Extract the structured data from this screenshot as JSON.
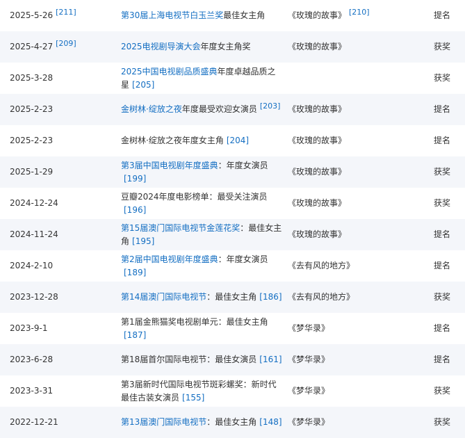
{
  "rows": [
    {
      "date": "2025-5-26",
      "date_ref": "[211]",
      "event_link": "第30届上海电视节白玉兰奖",
      "event_text": "最佳女主角",
      "event_ref": "",
      "work": "《玫瑰的故事》",
      "work_ref": "[210]",
      "result": "提名"
    },
    {
      "date": "2025-4-27",
      "date_ref": "[209]",
      "event_link": "2025电视剧导演大会",
      "event_text": "年度女主角奖",
      "event_ref": "",
      "work": "《玫瑰的故事》",
      "work_ref": "",
      "result": "获奖"
    },
    {
      "date": "2025-3-28",
      "date_ref": "",
      "event_link": "2025中国电视剧品质盛典",
      "event_text": "年度卓越品质之星",
      "event_ref": "[205]",
      "work": "",
      "work_ref": "",
      "result": "获奖"
    },
    {
      "date": "2025-2-23",
      "date_ref": "",
      "event_link": "金树林·绽放之夜",
      "event_text": "年度最受欢迎女演员",
      "event_ref": "[203]",
      "work": "《玫瑰的故事》",
      "work_ref": "",
      "result": "提名"
    },
    {
      "date": "2025-2-23",
      "date_ref": "",
      "event_link": "",
      "event_text": "金树林·绽放之夜年度女主角",
      "event_ref": "[204]",
      "work": "《玫瑰的故事》",
      "work_ref": "",
      "result": "提名"
    },
    {
      "date": "2025-1-29",
      "date_ref": "",
      "event_link": "第3届中国电视剧年度盛典",
      "event_text": "：年度女演员",
      "event_ref": "[199]",
      "work": "《玫瑰的故事》",
      "work_ref": "",
      "result": "获奖"
    },
    {
      "date": "2024-12-24",
      "date_ref": "",
      "event_link": "",
      "event_text": "豆瓣2024年度电影榜单：最受关注演员",
      "event_ref": "[196]",
      "work": "《玫瑰的故事》",
      "work_ref": "",
      "result": "获奖"
    },
    {
      "date": "2024-11-24",
      "date_ref": "",
      "event_link": "第15届澳门国际电视节金莲花奖",
      "event_text": "：最佳女主角",
      "event_ref": "[195]",
      "work": "《玫瑰的故事》",
      "work_ref": "",
      "result": "提名"
    },
    {
      "date": "2024-2-10",
      "date_ref": "",
      "event_link": "第2届中国电视剧年度盛典",
      "event_text": "：年度女演员",
      "event_ref": "[189]",
      "work": "《去有风的地方》",
      "work_ref": "",
      "result": "提名"
    },
    {
      "date": "2023-12-28",
      "date_ref": "",
      "event_link": "第14届澳门国际电视节",
      "event_text": "：最佳女主角",
      "event_ref": "[186]",
      "work": "《去有风的地方》",
      "work_ref": "",
      "result": "获奖"
    },
    {
      "date": "2023-9-1",
      "date_ref": "",
      "event_link": "",
      "event_text": "第1届金熊猫奖电视剧单元：最佳女主角",
      "event_ref": "[187]",
      "work": "《梦华录》",
      "work_ref": "",
      "result": "提名"
    },
    {
      "date": "2023-6-28",
      "date_ref": "",
      "event_link": "",
      "event_text": "第18届首尔国际电视节：最佳女演员",
      "event_ref": "[161]",
      "work": "《梦华录》",
      "work_ref": "",
      "result": "提名"
    },
    {
      "date": "2023-3-31",
      "date_ref": "",
      "event_link": "",
      "event_text": "第3届新时代国际电视节斑彩螺奖：新时代最佳古装女演员",
      "event_ref": "[155]",
      "work": "《梦华录》",
      "work_ref": "",
      "result": "获奖"
    },
    {
      "date": "2022-12-21",
      "date_ref": "",
      "event_link": "第13届澳门国际电视节",
      "event_text": "：最佳女主角",
      "event_ref": "[148]",
      "work": "《梦华录》",
      "work_ref": "",
      "result": "获奖"
    }
  ]
}
